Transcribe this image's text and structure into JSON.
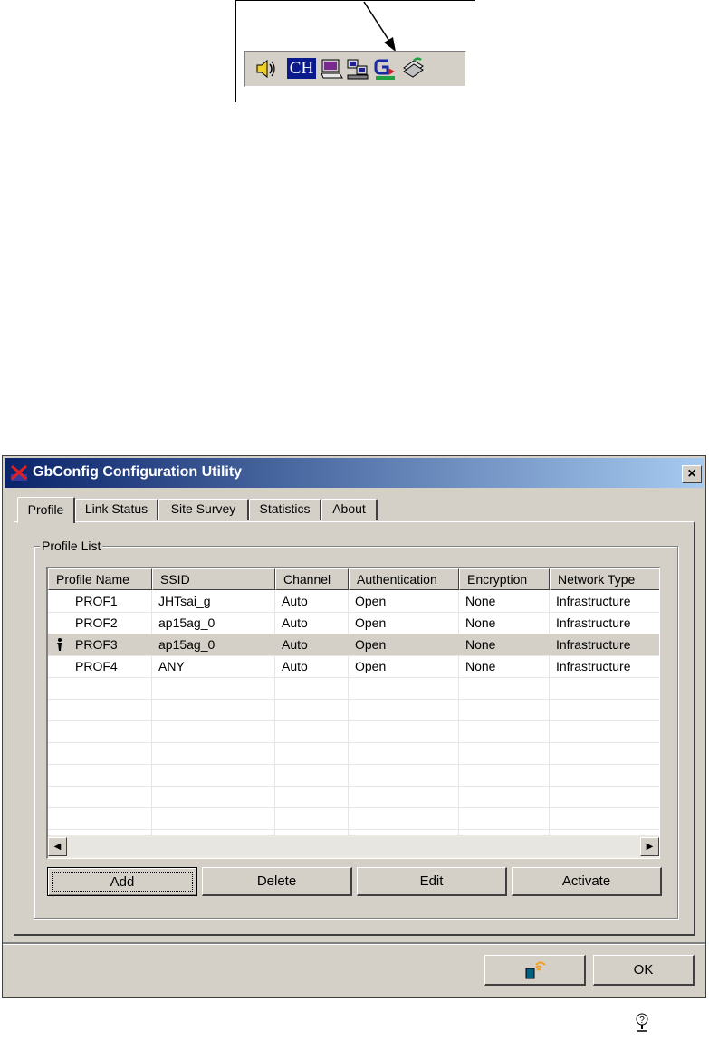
{
  "tray": {
    "ch_label": "CH",
    "icons": [
      "speaker-icon",
      "ch-language-icon",
      "monitor-icon",
      "network-computers-icon",
      "gbconfig-utility-icon",
      "network-cable-icon"
    ]
  },
  "dialog": {
    "title": "GbConfig Configuration Utility",
    "close_label": "×",
    "tabs": [
      {
        "label": "Profile"
      },
      {
        "label": "Link Status"
      },
      {
        "label": "Site Survey"
      },
      {
        "label": "Statistics"
      },
      {
        "label": "About"
      }
    ],
    "group_label": "Profile List",
    "columns": [
      "Profile Name",
      "SSID",
      "Channel",
      "Authentication",
      "Encryption",
      "Network Type"
    ],
    "rows": [
      {
        "active": false,
        "profile": "PROF1",
        "ssid": "JHTsai_g",
        "channel": "Auto",
        "auth": "Open",
        "enc": "None",
        "type": "Infrastructure"
      },
      {
        "active": false,
        "profile": "PROF2",
        "ssid": "ap15ag_0",
        "channel": "Auto",
        "auth": "Open",
        "enc": "None",
        "type": "Infrastructure"
      },
      {
        "active": true,
        "profile": "PROF3",
        "ssid": "ap15ag_0",
        "channel": "Auto",
        "auth": "Open",
        "enc": "None",
        "type": "Infrastructure"
      },
      {
        "active": false,
        "profile": "PROF4",
        "ssid": "ANY",
        "channel": "Auto",
        "auth": "Open",
        "enc": "None",
        "type": "Infrastructure"
      }
    ],
    "buttons": {
      "add": "Add",
      "delete": "Delete",
      "edit": "Edit",
      "activate": "Activate"
    },
    "ok_label": "OK"
  },
  "colors": {
    "title_start": "#0a246a",
    "title_end": "#a6caf0",
    "face": "#d4d0c8",
    "ch_bg": "#0a1a8c"
  }
}
